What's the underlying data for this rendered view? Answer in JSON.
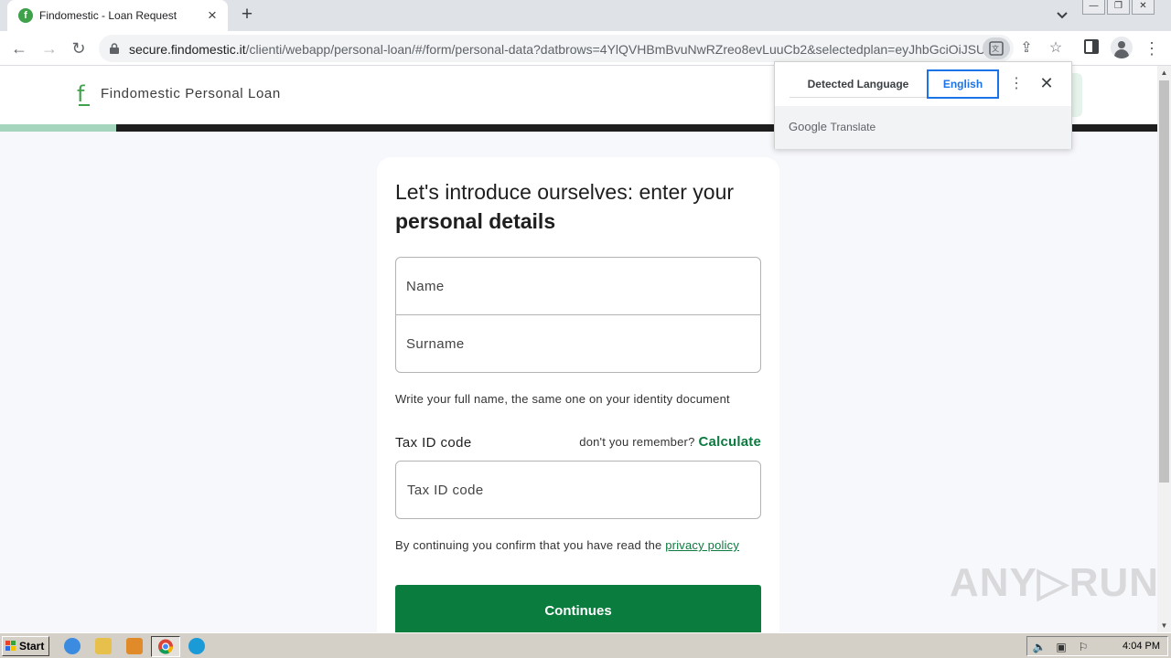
{
  "browser": {
    "tab_title": "Findomestic - Loan Request",
    "tab_favicon": "f",
    "new_tab_symbol": "+",
    "url_host": "secure.findomestic.it",
    "url_path": "/clienti/webapp/personal-loan/#/form/personal-data?datbrows=4YlQVHBmBvuNwRZreo8evLuuCb2&selectedplan=eyJhbGciOiJSUz..."
  },
  "translate": {
    "source_language": "Detected Language",
    "target_language": "English",
    "brand_google": "Google",
    "brand_translate": "Translate"
  },
  "site": {
    "logo_letter": "f",
    "name": "Findomestic Personal Loan",
    "progress_fraction": 0.1,
    "accent_color": "#0a7d3e",
    "progress_color": "#a6d5bd"
  },
  "form": {
    "headline_line1": "Let's introduce ourselves: enter your",
    "headline_bold": "personal details",
    "name_placeholder": "Name",
    "surname_placeholder": "Surname",
    "name_hint": "Write your full name, the same one on your identity document",
    "tax_label": "Tax ID code",
    "tax_question": "don't you remember?",
    "calculate_link": "Calculate",
    "tax_placeholder": "Tax ID code",
    "consent_text": "By continuing you confirm that you have read the",
    "privacy_link": "privacy policy",
    "submit_label": "Continues"
  },
  "watermark": "ANY▷RUN",
  "taskbar": {
    "start_label": "Start",
    "clock": "4:04 PM"
  }
}
